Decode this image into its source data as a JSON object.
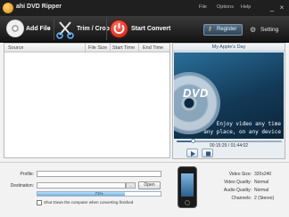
{
  "titlebar": {
    "title": "ahi DVD Ripper",
    "menu": [
      "File",
      "Options",
      "Help"
    ],
    "controls": [
      "_",
      "×"
    ]
  },
  "toolbar": {
    "add_file_label": "Add File",
    "add_file_dropdown": "▾",
    "trim_crop_label": "Trim / Crop",
    "start_convert_label": "Start Convert",
    "register_label": "Register",
    "settings_label": "Setting",
    "icons": [
      "disc-icon",
      "scissors-icon",
      "power-icon",
      "key-icon",
      "gear-icon"
    ]
  },
  "filelist": {
    "columns": [
      "Source",
      "File Size",
      "Start Time",
      "End Time"
    ],
    "rows": []
  },
  "preview": {
    "title": "My Apple's Day",
    "logo_text": "DVD",
    "tagline_1": "Enjoy video any time",
    "tagline_2": "any place, on any device",
    "time": "00:15:29 / 01:44:02",
    "seek_fraction": 0.149,
    "colors": {
      "video_top": "#2a6f9a",
      "video_bottom": "#0b2438"
    }
  },
  "output": {
    "profile_label": "Profile:",
    "profile_value": "",
    "destination_label": "Destination:",
    "destination_value": "",
    "browse_label": "...",
    "open_label": "Open",
    "progress_text": "71%",
    "progress_fraction": 0.71,
    "shutdown_label": "Shut Down the computer when converting finished"
  },
  "specs": {
    "video_size_label": "Video Size:",
    "video_size_value": "320x240",
    "video_quality_label": "Video Quality:",
    "video_quality_value": "Normal",
    "audio_quality_label": "Audio Quality:",
    "audio_quality_value": "Normal",
    "channels_label": "Channels:",
    "channels_value": "2 (Stereo)"
  }
}
